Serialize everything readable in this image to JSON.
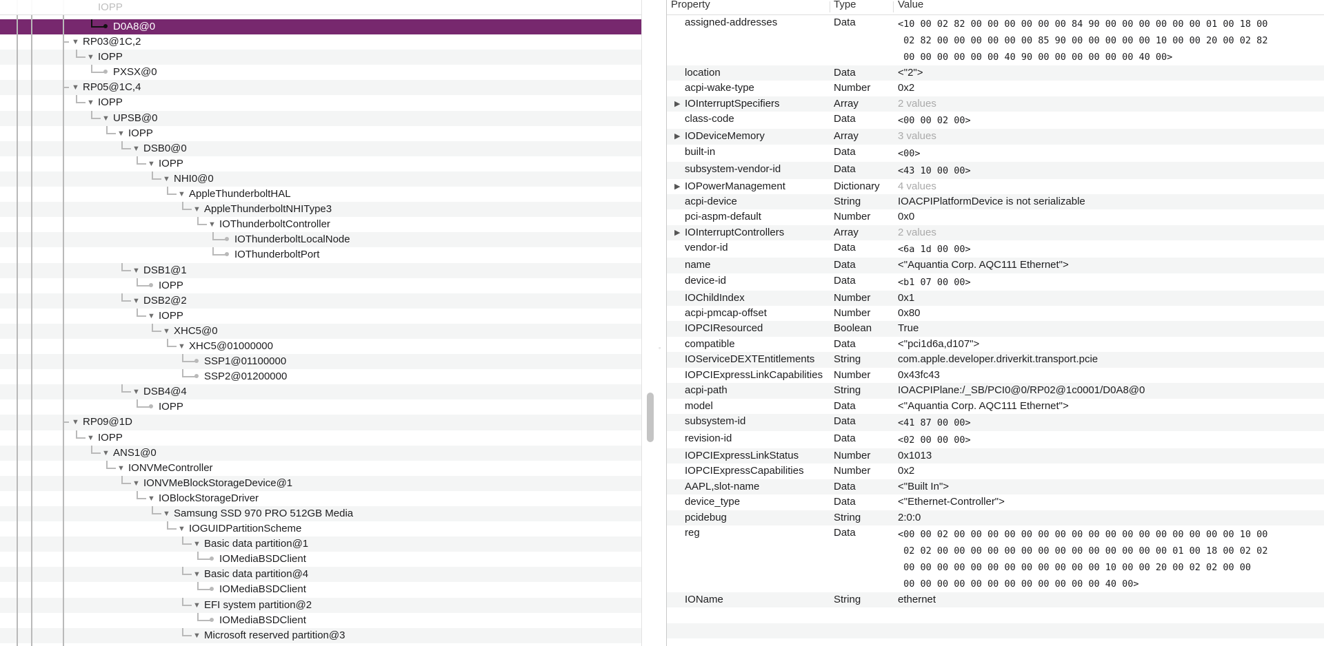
{
  "tree": {
    "top_partial": "IOPP",
    "items": [
      {
        "label": "D0A8@0",
        "level": 2,
        "kind": "leaf",
        "selected": true
      },
      {
        "label": "RP03@1C,2",
        "level": 0,
        "kind": "open"
      },
      {
        "label": "IOPP",
        "level": 1,
        "kind": "open"
      },
      {
        "label": "PXSX@0",
        "level": 2,
        "kind": "leaf"
      },
      {
        "label": "RP05@1C,4",
        "level": 0,
        "kind": "open"
      },
      {
        "label": "IOPP",
        "level": 1,
        "kind": "open"
      },
      {
        "label": "UPSB@0",
        "level": 2,
        "kind": "open"
      },
      {
        "label": "IOPP",
        "level": 3,
        "kind": "open"
      },
      {
        "label": "DSB0@0",
        "level": 4,
        "kind": "open"
      },
      {
        "label": "IOPP",
        "level": 5,
        "kind": "open"
      },
      {
        "label": "NHI0@0",
        "level": 6,
        "kind": "open"
      },
      {
        "label": "AppleThunderboltHAL",
        "level": 7,
        "kind": "open"
      },
      {
        "label": "AppleThunderboltNHIType3",
        "level": 8,
        "kind": "open"
      },
      {
        "label": "IOThunderboltController",
        "level": 9,
        "kind": "open"
      },
      {
        "label": "IOThunderboltLocalNode",
        "level": 10,
        "kind": "leaf"
      },
      {
        "label": "IOThunderboltPort",
        "level": 10,
        "kind": "leaf"
      },
      {
        "label": "DSB1@1",
        "level": 4,
        "kind": "open"
      },
      {
        "label": "IOPP",
        "level": 5,
        "kind": "leaf"
      },
      {
        "label": "DSB2@2",
        "level": 4,
        "kind": "open"
      },
      {
        "label": "IOPP",
        "level": 5,
        "kind": "open"
      },
      {
        "label": "XHC5@0",
        "level": 6,
        "kind": "open"
      },
      {
        "label": "XHC5@01000000",
        "level": 7,
        "kind": "open"
      },
      {
        "label": "SSP1@01100000",
        "level": 8,
        "kind": "leaf"
      },
      {
        "label": "SSP2@01200000",
        "level": 8,
        "kind": "leaf"
      },
      {
        "label": "DSB4@4",
        "level": 4,
        "kind": "open"
      },
      {
        "label": "IOPP",
        "level": 5,
        "kind": "leaf"
      },
      {
        "label": "RP09@1D",
        "level": 0,
        "kind": "open"
      },
      {
        "label": "IOPP",
        "level": 1,
        "kind": "open"
      },
      {
        "label": "ANS1@0",
        "level": 2,
        "kind": "open"
      },
      {
        "label": "IONVMeController",
        "level": 3,
        "kind": "open"
      },
      {
        "label": "IONVMeBlockStorageDevice@1",
        "level": 4,
        "kind": "open"
      },
      {
        "label": "IOBlockStorageDriver",
        "level": 5,
        "kind": "open"
      },
      {
        "label": "Samsung SSD 970 PRO 512GB Media",
        "level": 6,
        "kind": "open"
      },
      {
        "label": "IOGUIDPartitionScheme",
        "level": 7,
        "kind": "open"
      },
      {
        "label": "Basic data partition@1",
        "level": 8,
        "kind": "open"
      },
      {
        "label": "IOMediaBSDClient",
        "level": 9,
        "kind": "leaf"
      },
      {
        "label": "Basic data partition@4",
        "level": 8,
        "kind": "open"
      },
      {
        "label": "IOMediaBSDClient",
        "level": 9,
        "kind": "leaf"
      },
      {
        "label": "EFI system partition@2",
        "level": 8,
        "kind": "open"
      },
      {
        "label": "IOMediaBSDClient",
        "level": 9,
        "kind": "leaf"
      },
      {
        "label": "Microsoft reserved partition@3",
        "level": 8,
        "kind": "open"
      }
    ]
  },
  "columns": {
    "property": "Property",
    "type": "Type",
    "value": "Value"
  },
  "properties": [
    {
      "p": "assigned-addresses",
      "t": "Data",
      "v": "<10 00 02 82 00 00 00 00 00 00 84 90 00 00 00 00 00 00 01 00 18 00\n 02 82 00 00 00 00 00 00 85 90 00 00 00 00 00 10 00 00 20 00 02 82\n 00 00 00 00 00 00 40 90 00 00 00 00 00 00 40 00>",
      "mono": true
    },
    {
      "p": "location",
      "t": "Data",
      "v": "<\"2\">"
    },
    {
      "p": "acpi-wake-type",
      "t": "Number",
      "v": "0x2"
    },
    {
      "p": "IOInterruptSpecifiers",
      "t": "Array",
      "v": "2 values",
      "expandable": true
    },
    {
      "p": "class-code",
      "t": "Data",
      "v": "<00 00 02 00>",
      "mono": true
    },
    {
      "p": "IODeviceMemory",
      "t": "Array",
      "v": "3 values",
      "expandable": true
    },
    {
      "p": "built-in",
      "t": "Data",
      "v": "<00>",
      "mono": true
    },
    {
      "p": "subsystem-vendor-id",
      "t": "Data",
      "v": "<43 10 00 00>",
      "mono": true
    },
    {
      "p": "IOPowerManagement",
      "t": "Dictionary",
      "v": "4 values",
      "expandable": true
    },
    {
      "p": "acpi-device",
      "t": "String",
      "v": "IOACPIPlatformDevice is not serializable"
    },
    {
      "p": "pci-aspm-default",
      "t": "Number",
      "v": "0x0"
    },
    {
      "p": "IOInterruptControllers",
      "t": "Array",
      "v": "2 values",
      "expandable": true
    },
    {
      "p": "vendor-id",
      "t": "Data",
      "v": "<6a 1d 00 00>",
      "mono": true
    },
    {
      "p": "name",
      "t": "Data",
      "v": "<\"Aquantia Corp. AQC111 Ethernet\">"
    },
    {
      "p": "device-id",
      "t": "Data",
      "v": "<b1 07 00 00>",
      "mono": true
    },
    {
      "p": "IOChildIndex",
      "t": "Number",
      "v": "0x1"
    },
    {
      "p": "acpi-pmcap-offset",
      "t": "Number",
      "v": "0x80"
    },
    {
      "p": "IOPCIResourced",
      "t": "Boolean",
      "v": "True"
    },
    {
      "p": "compatible",
      "t": "Data",
      "v": "<\"pci1d6a,d107\">"
    },
    {
      "p": "IOServiceDEXTEntitlements",
      "t": "String",
      "v": "com.apple.developer.driverkit.transport.pcie"
    },
    {
      "p": "IOPCIExpressLinkCapabilities",
      "t": "Number",
      "v": "0x43fc43"
    },
    {
      "p": "acpi-path",
      "t": "String",
      "v": "IOACPIPlane:/_SB/PCI0@0/RP02@1c0001/D0A8@0"
    },
    {
      "p": "model",
      "t": "Data",
      "v": "<\"Aquantia Corp. AQC111 Ethernet\">"
    },
    {
      "p": "subsystem-id",
      "t": "Data",
      "v": "<41 87 00 00>",
      "mono": true
    },
    {
      "p": "revision-id",
      "t": "Data",
      "v": "<02 00 00 00>",
      "mono": true
    },
    {
      "p": "IOPCIExpressLinkStatus",
      "t": "Number",
      "v": "0x1013"
    },
    {
      "p": "IOPCIExpressCapabilities",
      "t": "Number",
      "v": "0x2"
    },
    {
      "p": "AAPL,slot-name",
      "t": "Data",
      "v": "<\"Built In\">"
    },
    {
      "p": "device_type",
      "t": "Data",
      "v": "<\"Ethernet-Controller\">"
    },
    {
      "p": "pcidebug",
      "t": "String",
      "v": "2:0:0"
    },
    {
      "p": "reg",
      "t": "Data",
      "v": "<00 00 02 00 00 00 00 00 00 00 00 00 00 00 00 00 00 00 00 00 10 00\n 02 02 00 00 00 00 00 00 00 00 00 00 00 00 00 00 01 00 18 00 02 02\n 00 00 00 00 00 00 00 00 00 00 00 00 10 00 00 20 00 02 02 00 00\n 00 00 00 00 00 00 00 00 00 00 00 00 40 00>",
      "mono": true
    },
    {
      "p": "IOName",
      "t": "String",
      "v": "ethernet"
    }
  ]
}
